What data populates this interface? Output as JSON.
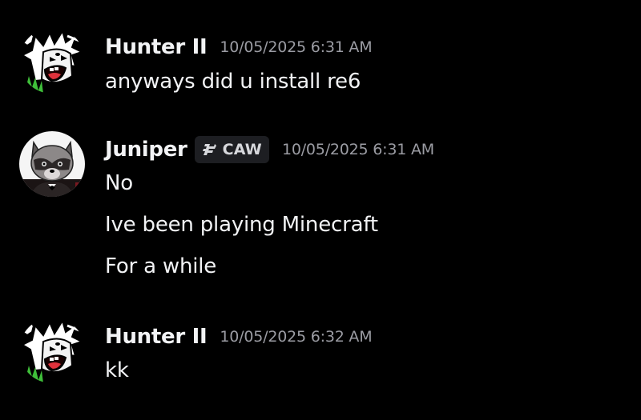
{
  "messages": [
    {
      "author": "Hunter II",
      "timestamp": "10/05/2025 6:31 AM",
      "avatar_icon": "cartoon-screaming-character-avatar",
      "lines": [
        "anyways did u install re6"
      ]
    },
    {
      "author": "Juniper",
      "timestamp": "10/05/2025 6:31 AM",
      "avatar_icon": "raccoon-avatar",
      "tag": {
        "label": "CAW",
        "icon": "guild-tag-icon"
      },
      "lines": [
        "No",
        "Ive been playing Minecraft",
        "For a while"
      ]
    },
    {
      "author": "Hunter II",
      "timestamp": "10/05/2025 6:32 AM",
      "avatar_icon": "cartoon-screaming-character-avatar",
      "lines": [
        "kk"
      ]
    }
  ],
  "colors": {
    "background": "#000000",
    "text": "#f2f3f5",
    "timestamp": "#9b9ca3",
    "tag_background": "#1d1e22"
  }
}
